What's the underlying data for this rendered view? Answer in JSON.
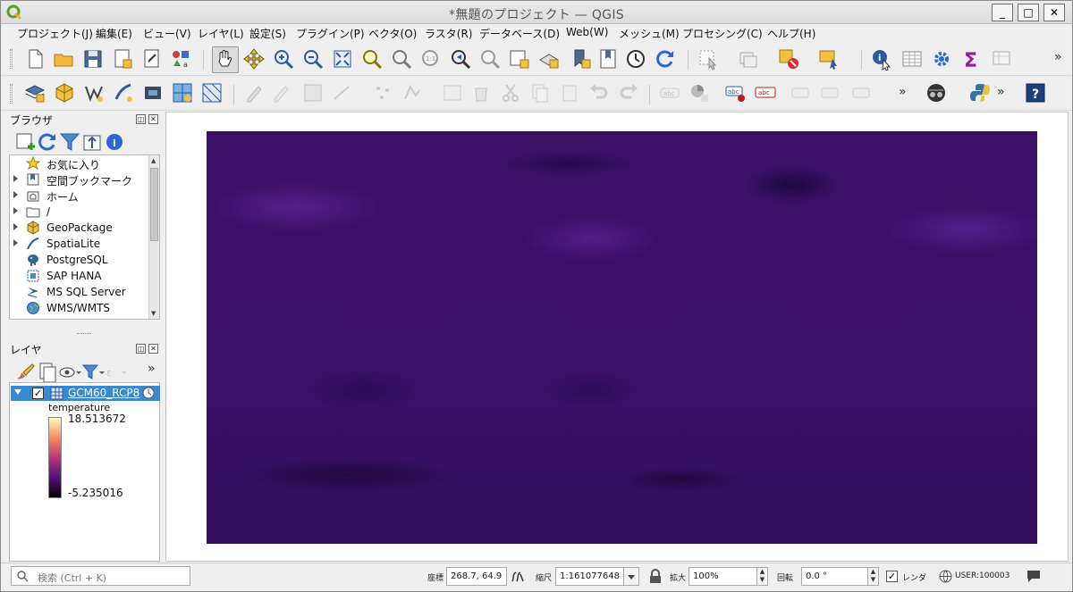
{
  "window": {
    "title": "*無題のプロジェクト — QGIS",
    "minimize_label": "_",
    "maximize_label": "□",
    "close_label": "✕"
  },
  "menu": [
    "プロジェクト(J)",
    "編集(E)",
    "ビュー(V)",
    "レイヤ(L)",
    "設定(S)",
    "プラグイン(P)",
    "ベクタ(O)",
    "ラスタ(R)",
    "データベース(D)",
    "Web(W)",
    "メッシュ(M)",
    "プロセシング(C)",
    "ヘルプ(H)"
  ],
  "toolbar": {
    "overflow_label": "»"
  },
  "browser_panel": {
    "title": "ブラウザ",
    "items": [
      {
        "label": "お気に入り",
        "icon": "star-icon",
        "expandable": false
      },
      {
        "label": "空間ブックマーク",
        "icon": "bookmark-icon",
        "expandable": true
      },
      {
        "label": "ホーム",
        "icon": "home-folder-icon",
        "expandable": true
      },
      {
        "label": "/",
        "icon": "folder-icon",
        "expandable": true
      },
      {
        "label": "GeoPackage",
        "icon": "geopackage-icon",
        "expandable": true
      },
      {
        "label": "SpatiaLite",
        "icon": "spatialite-icon",
        "expandable": true
      },
      {
        "label": "PostgreSQL",
        "icon": "postgresql-icon",
        "expandable": false
      },
      {
        "label": "SAP HANA",
        "icon": "sap-hana-icon",
        "expandable": false
      },
      {
        "label": "MS SQL Server",
        "icon": "mssql-icon",
        "expandable": false
      },
      {
        "label": "WMS/WMTS",
        "icon": "wms-globe-icon",
        "expandable": false
      }
    ]
  },
  "layers_panel": {
    "title": "レイヤ",
    "layer": {
      "name": "GCM60_RCP8",
      "visible": true,
      "legend_title": "temperature",
      "max_value": "18.513672",
      "min_value": "-5.235016"
    }
  },
  "statusbar": {
    "search_placeholder": "検索 (Ctrl + K)",
    "coord_label": "座標",
    "coord_value": "268.7, 64.9",
    "scale_label": "縮尺",
    "scale_value": "1:161077648",
    "magnifier_label": "拡大",
    "magnifier_value": "100%",
    "rotation_label": "回転",
    "rotation_value": "0.0 °",
    "render_label": "レンダ",
    "render_checked": true,
    "crs_label": "USER:100003"
  },
  "colors": {
    "selection": "#3a88d0",
    "raster_base": "#3c0f68",
    "raster_cool": "#2a0a4e",
    "raster_warm": "#5a1c88"
  }
}
